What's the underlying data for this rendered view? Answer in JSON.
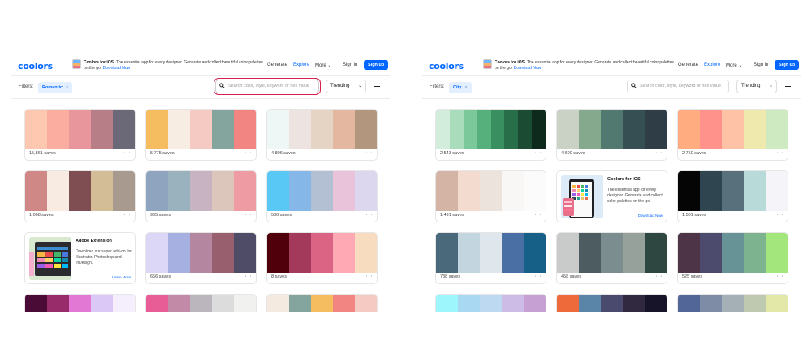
{
  "left": {
    "header": {
      "logo": "coolors",
      "promo_title": "Coolors for iOS",
      "promo_text": "The essential app for every designer. Generate and collect beautiful color palettes on the go.",
      "promo_link": "Download Now",
      "nav_generate": "Generate",
      "nav_explore": "Explore",
      "nav_more": "More",
      "sign_in": "Sign in",
      "sign_up": "Sign up"
    },
    "filters": {
      "label": "Filters:",
      "chip": "Romantic",
      "search_placeholder": "Search color, style, keyword or hex value",
      "sort": "Trending"
    },
    "palettes": [
      {
        "colors": [
          "#fdc7b0",
          "#fbaea0",
          "#e8969b",
          "#b87e87",
          "#6b6878"
        ],
        "saves": "15,861 saves"
      },
      {
        "colors": [
          "#f6bd60",
          "#f7ede2",
          "#f5cac3",
          "#84a59d",
          "#f28482"
        ],
        "saves": "5,775 saves"
      },
      {
        "colors": [
          "#eef7f5",
          "#ede3e0",
          "#e5d3c3",
          "#e3b7a0",
          "#b2967d"
        ],
        "saves": "4,806 saves"
      },
      {
        "colors": [
          "#cf8885",
          "#f7ebe2",
          "#7e4e52",
          "#d2bd96",
          "#a89a8e"
        ],
        "saves": "1,068 saves"
      },
      {
        "colors": [
          "#8fa4be",
          "#99b2bd",
          "#c8b3c3",
          "#dcc5bb",
          "#ee9ba3"
        ],
        "saves": "965 saves"
      },
      {
        "colors": [
          "#5ac8f5",
          "#86b7e9",
          "#b3bfd3",
          "#e9c3d9",
          "#dcd6ef"
        ],
        "saves": "530 saves"
      },
      {
        "colors": [
          "#dcd6f7",
          "#a6b1e1",
          "#b4869f",
          "#985f6f",
          "#4e4c67"
        ],
        "saves": "656 saves"
      },
      {
        "colors": [
          "#4f000b",
          "#a3395b",
          "#db6383",
          "#ffa9b5",
          "#f8dcc0"
        ],
        "saves": "8 saves"
      }
    ],
    "promo_card": {
      "title": "Adobe Extension",
      "text": "Download our super add-on for Illustrator, Photoshop and InDesign.",
      "link": "Learn More"
    },
    "partial_rows": [
      [
        "#4a0c37",
        "#982c6b",
        "#e277d4",
        "#dcc8f6",
        "#f4eefd"
      ],
      [
        "#e85d96",
        "#c28aa6",
        "#bbb5bd",
        "#dcdcdc",
        "#f1f1f0"
      ],
      [
        "#f5eadf",
        "#84a59d",
        "#f6bd60",
        "#f28482",
        "#f5cac3"
      ]
    ]
  },
  "right": {
    "header": {
      "logo": "coolors",
      "promo_title": "Coolors for iOS",
      "promo_text": "The essential app for every designer. Generate and collect beautiful color palettes on the go.",
      "promo_link": "Download Now",
      "nav_generate": "Generate",
      "nav_explore": "Explore",
      "nav_more": "More",
      "sign_in": "Sign in",
      "sign_up": "Sign up"
    },
    "filters": {
      "label": "Filters:",
      "chip": "City",
      "search_placeholder": "Search color, style, keyword or hex value",
      "sort": "Trending"
    },
    "palettes": [
      {
        "colors": [
          "#d2eddc",
          "#a9dcba",
          "#7bc89a",
          "#55b07b",
          "#3a8f60",
          "#286e48",
          "#1b4c33",
          "#0e2a1c"
        ],
        "saves": "2,543 saves"
      },
      {
        "colors": [
          "#cad2c5",
          "#84a98c",
          "#52796f",
          "#354f52",
          "#2f3e46"
        ],
        "saves": "4,600 saves"
      },
      {
        "colors": [
          "#ffac81",
          "#ff928b",
          "#fec3a6",
          "#efe9ae",
          "#cdeac0"
        ],
        "saves": "2,750 saves"
      },
      {
        "colors": [
          "#d4b5a5",
          "#f3dccf",
          "#ece3dd",
          "#f8f7f5",
          "#fbfbfb"
        ],
        "saves": "1,491 saves"
      },
      {
        "colors": [
          "#050505",
          "#2f4550",
          "#586f7c",
          "#b8dbd9",
          "#f4f4f9"
        ],
        "saves": "1,501 saves"
      },
      {
        "colors": [
          "#4a6a7b",
          "#c3d6df",
          "#dfe7ec",
          "#4a6fa5",
          "#166088"
        ],
        "saves": "738 saves"
      },
      {
        "colors": [
          "#c9cbca",
          "#4c5c60",
          "#7b8d8e",
          "#97a19c",
          "#2f4741"
        ],
        "saves": "458 saves"
      },
      {
        "colors": [
          "#4d3447",
          "#4c4b6d",
          "#689396",
          "#7eb38f",
          "#a2e67c"
        ],
        "saves": "525 saves"
      }
    ],
    "promo_card": {
      "title": "Coolors for iOS",
      "text": "The essential app for every designer. Generate and collect color palettes on the go.",
      "link": "Download Now"
    },
    "partial_rows": [
      [
        "#9cf6fb",
        "#a8d8f2",
        "#bcd9f1",
        "#cdbde6",
        "#c69fd3"
      ],
      [
        "#ee6a3a",
        "#5b84a9",
        "#4a4a6f",
        "#30293f",
        "#17142a"
      ],
      [
        "#526797",
        "#7f8ca6",
        "#a5b0b6",
        "#bec9b0",
        "#e3e7a8"
      ]
    ]
  }
}
